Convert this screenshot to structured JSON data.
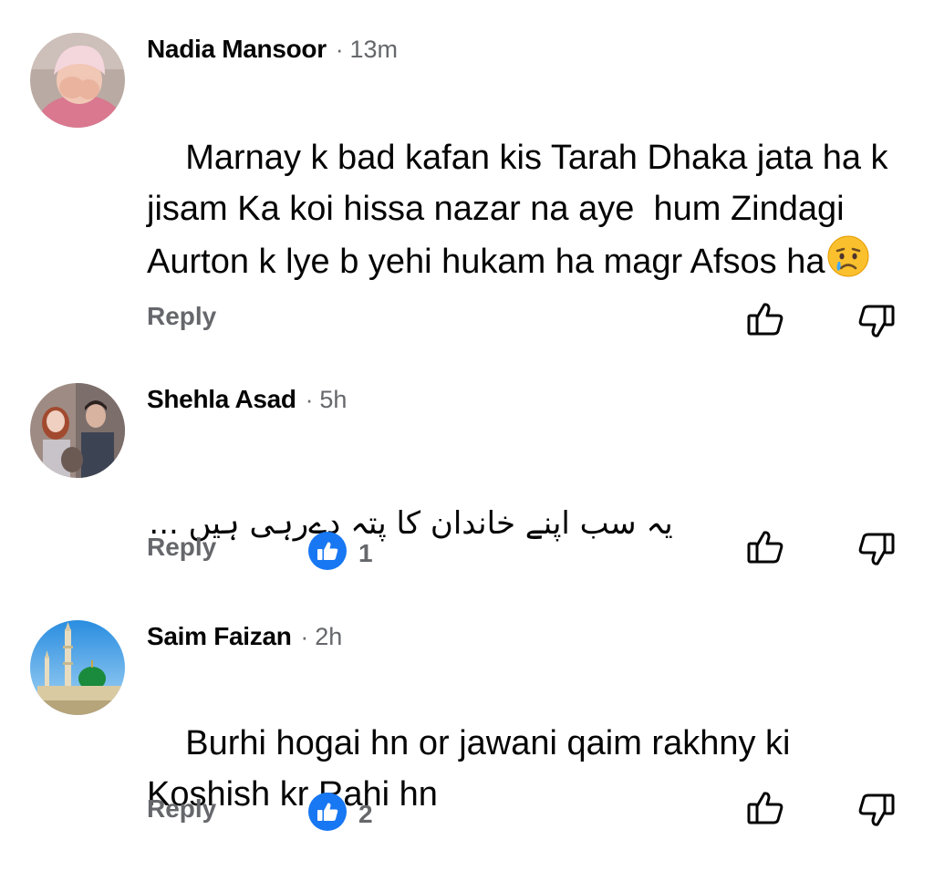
{
  "comments": [
    {
      "name": "Nadia Mansoor",
      "separator": "·",
      "time": "13m",
      "text": "Marnay k bad kafan kis Tarah Dhaka jata ha k jisam Ka koi hissa nazar na aye  hum Zindagi Aurton k lye b yehi hukam ha magr Afsos ha",
      "emoji": "crying-face",
      "reply_label": "Reply",
      "reaction_count": null
    },
    {
      "name": "Shehla Asad",
      "separator": "·",
      "time": "5h",
      "text": "یہ سب اپنے خاندان کا پتہ دے‌رہی ہیں ...",
      "reply_label": "Reply",
      "reaction_count": "1"
    },
    {
      "name": "Saim Faizan",
      "separator": "·",
      "time": "2h",
      "text": "Burhi hogai hn or jawani qaim rakhny ki Koshish kr Rahi hn",
      "reply_label": "Reply",
      "reaction_count": "2"
    }
  ],
  "icons": {
    "like_badge": "like-badge-icon",
    "upvote": "thumbs-up-outline-icon",
    "downvote": "thumbs-down-outline-icon"
  },
  "colors": {
    "primary_text": "#050505",
    "secondary_text": "#65676b",
    "like_blue": "#1877f2"
  }
}
